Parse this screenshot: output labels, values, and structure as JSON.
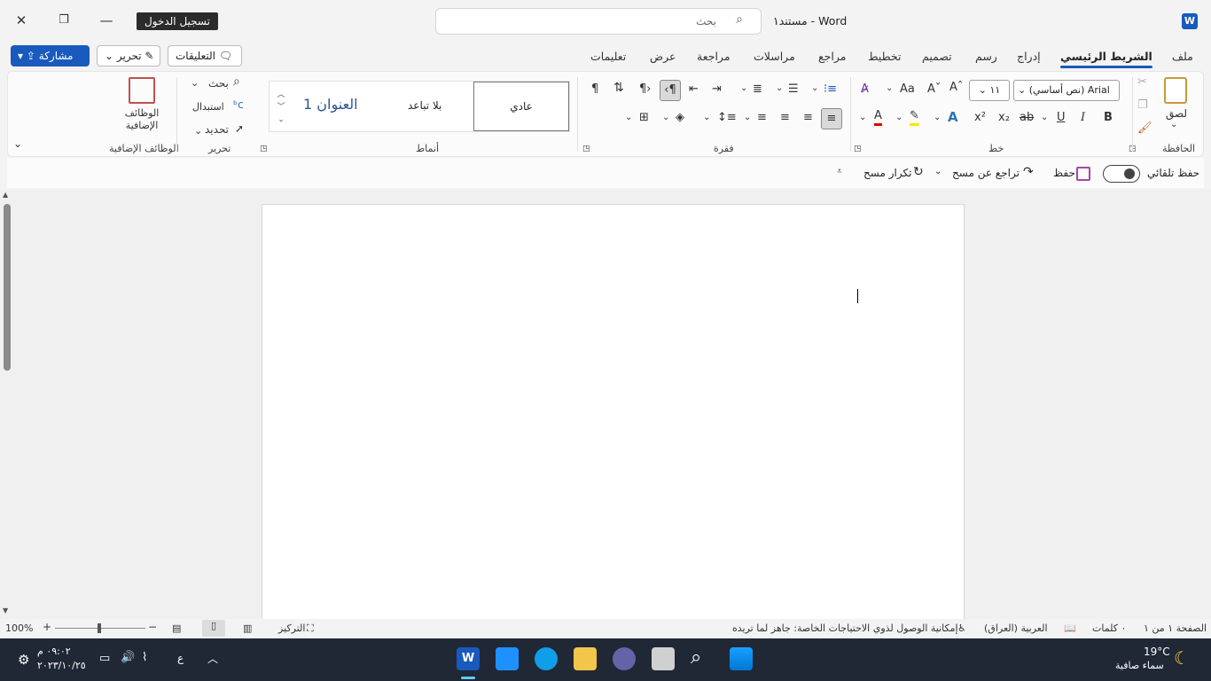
{
  "title_bar": {
    "doc_title": "مستند١ - Word",
    "sign_in": "تسجيل الدخول",
    "search_placeholder": "بحث"
  },
  "tabs": [
    {
      "label": "ملف"
    },
    {
      "label": "الشريط الرئيسي",
      "active": true
    },
    {
      "label": "إدراج"
    },
    {
      "label": "رسم"
    },
    {
      "label": "تصميم"
    },
    {
      "label": "تخطيط"
    },
    {
      "label": "مراجع"
    },
    {
      "label": "مراسلات"
    },
    {
      "label": "مراجعة"
    },
    {
      "label": "عرض"
    },
    {
      "label": "تعليمات"
    }
  ],
  "actions": {
    "comments": "التعليقات",
    "edit": "تحرير",
    "share": "مشاركة"
  },
  "ribbon": {
    "clipboard": {
      "paste": "لصق",
      "label": "الحافظة"
    },
    "font": {
      "name": "(نص أساسي) Arial",
      "size": "١١",
      "label": "خط"
    },
    "paragraph": {
      "label": "فقرة"
    },
    "styles": {
      "normal": "عادي",
      "no_spacing": "بلا تباعد",
      "heading1": "العنوان 1",
      "label": "أنماط"
    },
    "editing": {
      "find": "بحث",
      "replace": "استبدال",
      "select": "تحديد",
      "label": "تحرير"
    },
    "addins": {
      "button": "الوظائف الإضافية",
      "label": "الوظائف الإضافية"
    }
  },
  "qat": {
    "autosave": "حفظ تلقائي",
    "save": "حفظ",
    "undo": "تراجع عن مسح",
    "redo": "تكرار مسح"
  },
  "status_bar": {
    "page": "الصفحة ١ من ١",
    "words": "٠ كلمات",
    "language": "العربية (العراق)",
    "accessibility": "إمكانية الوصول لذوي الاحتياجات الخاصة: جاهز لما تريده",
    "focus": "التركيز",
    "zoom": "100%"
  },
  "taskbar": {
    "weather_temp": "19°C",
    "weather_text": "سماء صافية",
    "time": "٠٩:٠٢ م",
    "date": "٢٠٢٣/١٠/٢٥",
    "lang_indicator": "ع"
  },
  "colors": {
    "accent": "#185abd",
    "taskbar": "#202836"
  }
}
